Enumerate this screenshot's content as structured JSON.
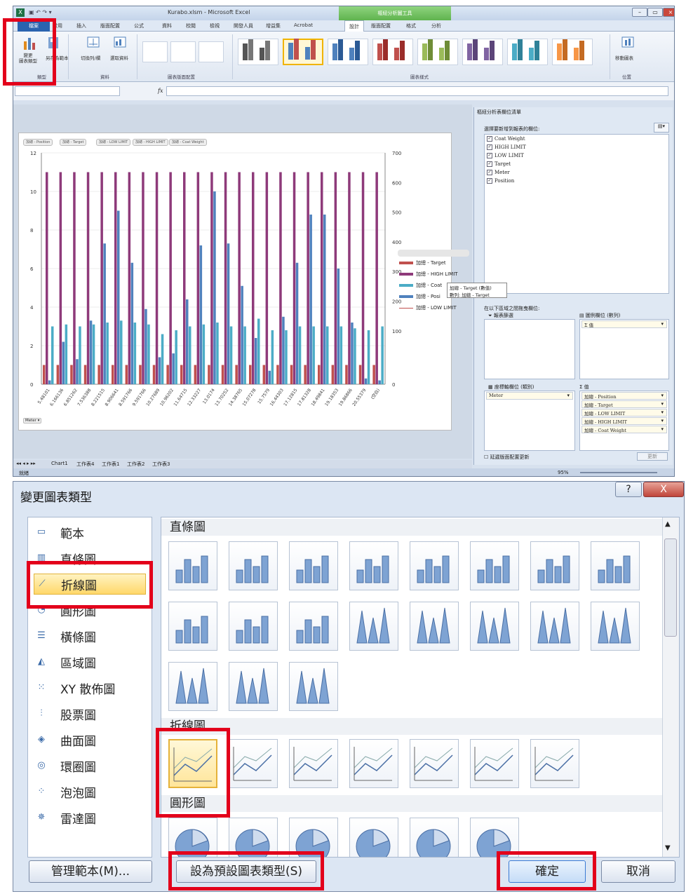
{
  "excel": {
    "title": "Kurabo.xlsm - Microsoft Excel",
    "context_tools": "樞紐分析圖工具",
    "tabs": [
      "檔案",
      "常用",
      "插入",
      "版面配置",
      "公式",
      "資料",
      "校閱",
      "檢視",
      "開發人員",
      "增益集",
      "Acrobat",
      "設計",
      "版面配置",
      "格式",
      "分析"
    ],
    "active_tab": "設計",
    "ribbon": {
      "change_type": "變更\n圖表類型",
      "save_template": "另存為範本",
      "switch_row_col": "切換列/欄",
      "select_data": "選取資料",
      "move_chart": "移動圖表",
      "groups": {
        "type": "類型",
        "data": "資料",
        "layouts": "圖表版面配置",
        "styles": "圖表樣式",
        "location": "位置"
      }
    },
    "formula_bar": {
      "fx": "fx"
    },
    "chart": {
      "filter_buttons": [
        "加總 - Position",
        "加總 - Target",
        "加總 - LOW LIMIT",
        "加總 - HIGH LIMIT",
        "加總 - Coat Weight"
      ],
      "axis_filter": "Meter ▾",
      "legend": [
        {
          "name": "加總 - Target",
          "color": "#c0504d"
        },
        {
          "name": "加總 - HIGH LIMIT",
          "color": "#8e3a7a"
        },
        {
          "name": "加總 - Coat",
          "color": "#4bacc6"
        },
        {
          "name": "加總 - Posi",
          "color": "#4f81bd"
        },
        {
          "name": "加總 - LOW LIMIT",
          "color": "#c0504d"
        }
      ],
      "tooltip_line1": "加總 - Target (數值)",
      "tooltip_line2": "數列: 加總 - Target",
      "y_left": [
        "12",
        "10",
        "8",
        "6",
        "4",
        "2",
        "0"
      ],
      "y_right": [
        "700",
        "600",
        "500",
        "400",
        "300",
        "200",
        "100",
        "0"
      ]
    },
    "chart_data": {
      "type": "bar",
      "title": "",
      "categories": [
        "5.48101",
        "6.166136",
        "6.851262",
        "7.536388",
        "8.221515",
        "8.906641",
        "8.591766",
        "9.591766",
        "10.27689",
        "10.96202",
        "11.64715",
        "12.33227",
        "13.0174",
        "13.70252",
        "14.38765",
        "15.07278",
        "15.7579",
        "16.44303",
        "17.12815",
        "17.81328",
        "18.49841",
        "19.18353",
        "19.86866",
        "20.55379",
        "(空白)"
      ],
      "series": [
        {
          "name": "加總 - HIGH LIMIT",
          "color": "#8e3a7a",
          "values": [
            11,
            11,
            11,
            11,
            11,
            11,
            11,
            11,
            11,
            11,
            11,
            11,
            11,
            11,
            11,
            11,
            11,
            11,
            11,
            11,
            11,
            11,
            11,
            11,
            11
          ]
        },
        {
          "name": "加總 - Position",
          "color": "#4f81bd",
          "values": [
            0.2,
            2.2,
            1.3,
            3.3,
            7.3,
            9.0,
            6.3,
            3.9,
            1.4,
            1.6,
            4.4,
            7.2,
            10.0,
            7.3,
            5.1,
            2.4,
            0.7,
            3.5,
            6.3,
            8.8,
            8.8,
            6.0,
            3.2,
            0.3,
            0.2
          ]
        },
        {
          "name": "加總 - Coat",
          "color": "#4bacc6",
          "values": [
            3.0,
            3.1,
            3.0,
            3.1,
            3.2,
            3.3,
            3.2,
            3.1,
            2.6,
            2.8,
            3.0,
            3.1,
            3.2,
            3.0,
            3.0,
            3.4,
            2.8,
            2.8,
            3.0,
            3.0,
            3.0,
            3.0,
            2.9,
            2.8,
            3.0
          ]
        },
        {
          "name": "加總 - Target",
          "color": "#c0504d",
          "values": [
            1,
            1,
            1,
            1,
            1,
            1,
            1,
            1,
            1,
            1,
            1,
            1,
            1,
            1,
            1,
            1,
            1,
            1,
            1,
            1,
            1,
            1,
            1,
            1,
            1
          ]
        }
      ],
      "ylim": [
        0,
        12
      ],
      "y2lim": [
        0,
        700
      ]
    },
    "pane": {
      "title": "樞紐分析表欄位清單",
      "choose": "選擇要新增到報表的欄位:",
      "fields": [
        "Coat Weight",
        "HIGH LIMIT",
        "LOW LIMIT",
        "Target",
        "Meter",
        "Position"
      ],
      "drag": "在以下區域之間拖曳欄位:",
      "filter": "報表篩選",
      "legend": "圖例欄位 (數列)",
      "sigma": "Σ 值",
      "axis": "座標軸欄位 (類別)",
      "values": "Σ 值",
      "axis_field": "Meter",
      "value_fields": [
        "加總 - Position",
        "加總 - Target",
        "加總 - LOW LIMIT",
        "加總 - HIGH LIMIT",
        "加總 - Coat Weight"
      ],
      "defer": "延遲版面配置更新",
      "update": "更新"
    },
    "sheet_tabs": [
      "Chart1",
      "工作表4",
      "工作表1",
      "工作表2",
      "工作表3"
    ],
    "status": {
      "ready": "就緒",
      "zoom": "95%"
    }
  },
  "dialog": {
    "title": "變更圖表類型",
    "help": "?",
    "close": "X",
    "categories": [
      {
        "label": "範本",
        "icon": "▭"
      },
      {
        "label": "直條圖",
        "icon": "▥"
      },
      {
        "label": "折線圖",
        "icon": "⟋"
      },
      {
        "label": "圓形圖",
        "icon": "◔"
      },
      {
        "label": "橫條圖",
        "icon": "☰"
      },
      {
        "label": "區域圖",
        "icon": "◭"
      },
      {
        "label": "XY 散佈圖",
        "icon": "⁙"
      },
      {
        "label": "股票圖",
        "icon": "⫶"
      },
      {
        "label": "曲面圖",
        "icon": "◈"
      },
      {
        "label": "環圈圖",
        "icon": "◎"
      },
      {
        "label": "泡泡圖",
        "icon": "⁘"
      },
      {
        "label": "雷達圖",
        "icon": "✵"
      }
    ],
    "sections": [
      "直條圖",
      "折線圖",
      "圓形圖"
    ],
    "buttons": {
      "manage": "管理範本(M)...",
      "default": "設為預設圖表類型(S)",
      "ok": "確定",
      "cancel": "取消"
    }
  }
}
